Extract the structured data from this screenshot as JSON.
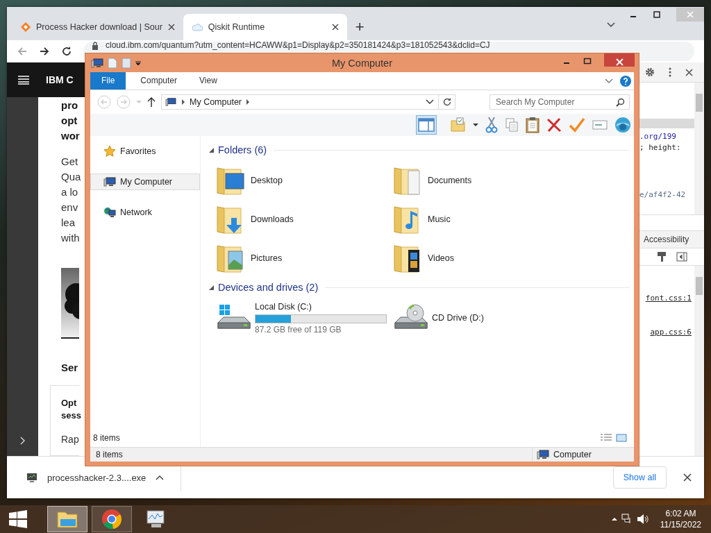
{
  "browser": {
    "tabs": [
      {
        "title": "Process Hacker download | Sour",
        "selected": false
      },
      {
        "title": "Qiskit Runtime",
        "selected": true
      }
    ],
    "new_tab": "+",
    "url": "cloud.ibm.com/quantum?utm_content=HCAWW&p1=Display&p2=350181424&p3=181052543&dclid=CJ",
    "page": {
      "brand": "IBM C",
      "intro": [
        "pro",
        "opt",
        "wor"
      ],
      "paragraph": [
        "Get",
        "Qua",
        "a lo",
        "env",
        "lea",
        "with"
      ],
      "heading": "Ser",
      "card": {
        "title": [
          "Opt",
          "sess"
        ],
        "text": "Rap"
      }
    },
    "devtools": {
      "code": [
        ".org/199",
        "; height:",
        "e/af4f2-42"
      ],
      "tab": "Accessibility",
      "links": [
        "font.css:1",
        "app.css:6"
      ]
    },
    "download": {
      "file": "processhacker-2.3....exe",
      "show_all": "Show all"
    }
  },
  "explorer": {
    "title": "My Computer",
    "ribbon_tabs": [
      {
        "label": "File",
        "selected": true
      },
      {
        "label": "Computer",
        "selected": false
      },
      {
        "label": "View",
        "selected": false
      }
    ],
    "address": "My Computer",
    "search": {
      "placeholder": "Search My Computer"
    },
    "nav": [
      {
        "label": "Favorites",
        "kind": "favorites",
        "selected": false
      },
      {
        "label": "My Computer",
        "kind": "computer",
        "selected": true
      },
      {
        "label": "Network",
        "kind": "network",
        "selected": false
      }
    ],
    "groups": [
      {
        "title": "Folders (6)",
        "items": [
          {
            "name": "Desktop",
            "kind": "desktop"
          },
          {
            "name": "Documents",
            "kind": "documents"
          },
          {
            "name": "Downloads",
            "kind": "downloads"
          },
          {
            "name": "Music",
            "kind": "music"
          },
          {
            "name": "Pictures",
            "kind": "pictures"
          },
          {
            "name": "Videos",
            "kind": "videos"
          }
        ]
      },
      {
        "title": "Devices and drives (2)",
        "items": [
          {
            "name": "Local Disk (C:)",
            "kind": "disk",
            "level": 0.27,
            "free": "87.2 GB free of 119 GB"
          },
          {
            "name": "CD Drive (D:)",
            "kind": "cd"
          }
        ]
      }
    ],
    "item_count": "8 items",
    "status": {
      "count": "8 items",
      "location": "Computer"
    }
  },
  "taskbar": {
    "apps": [
      {
        "kind": "explorer",
        "running": true,
        "active": true
      },
      {
        "kind": "chrome",
        "running": true,
        "active": false
      },
      {
        "kind": "monitor",
        "running": false,
        "active": false
      }
    ],
    "time": "6:02 AM",
    "date": "11/15/2022"
  }
}
